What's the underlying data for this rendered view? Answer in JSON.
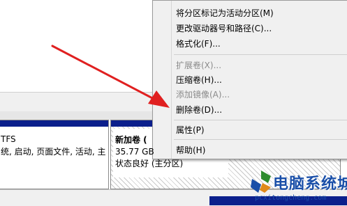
{
  "context_menu": {
    "items": [
      {
        "label": "将分区标记为活动分区(M)",
        "enabled": true
      },
      {
        "label": "更改驱动器号和路径(C)...",
        "enabled": true
      },
      {
        "label": "格式化(F)...",
        "enabled": true
      },
      {
        "label": "扩展卷(X)...",
        "enabled": false
      },
      {
        "label": "压缩卷(H)...",
        "enabled": true
      },
      {
        "label": "添加镜像(A)...",
        "enabled": false
      },
      {
        "label": "删除卷(D)...",
        "enabled": true
      },
      {
        "label": "属性(P)",
        "enabled": true
      },
      {
        "label": "帮助(H)",
        "enabled": true
      }
    ]
  },
  "volumes": [
    {
      "fs_line": "TFS",
      "status_line": "统, 启动, 页面文件, 活动, 主"
    },
    {
      "name": "新加卷 (",
      "size_line": "35.77 GB",
      "status_line": "状态良好 (主分区)"
    }
  ],
  "watermark": {
    "title": "电脑系统城",
    "url": "pcxitongcheng.com"
  },
  "colors": {
    "volume_bar": "#0b1f8c",
    "arrow": "#e02020",
    "menu_bg": "#f0f0f0",
    "watermark": "#1a4fa8"
  }
}
